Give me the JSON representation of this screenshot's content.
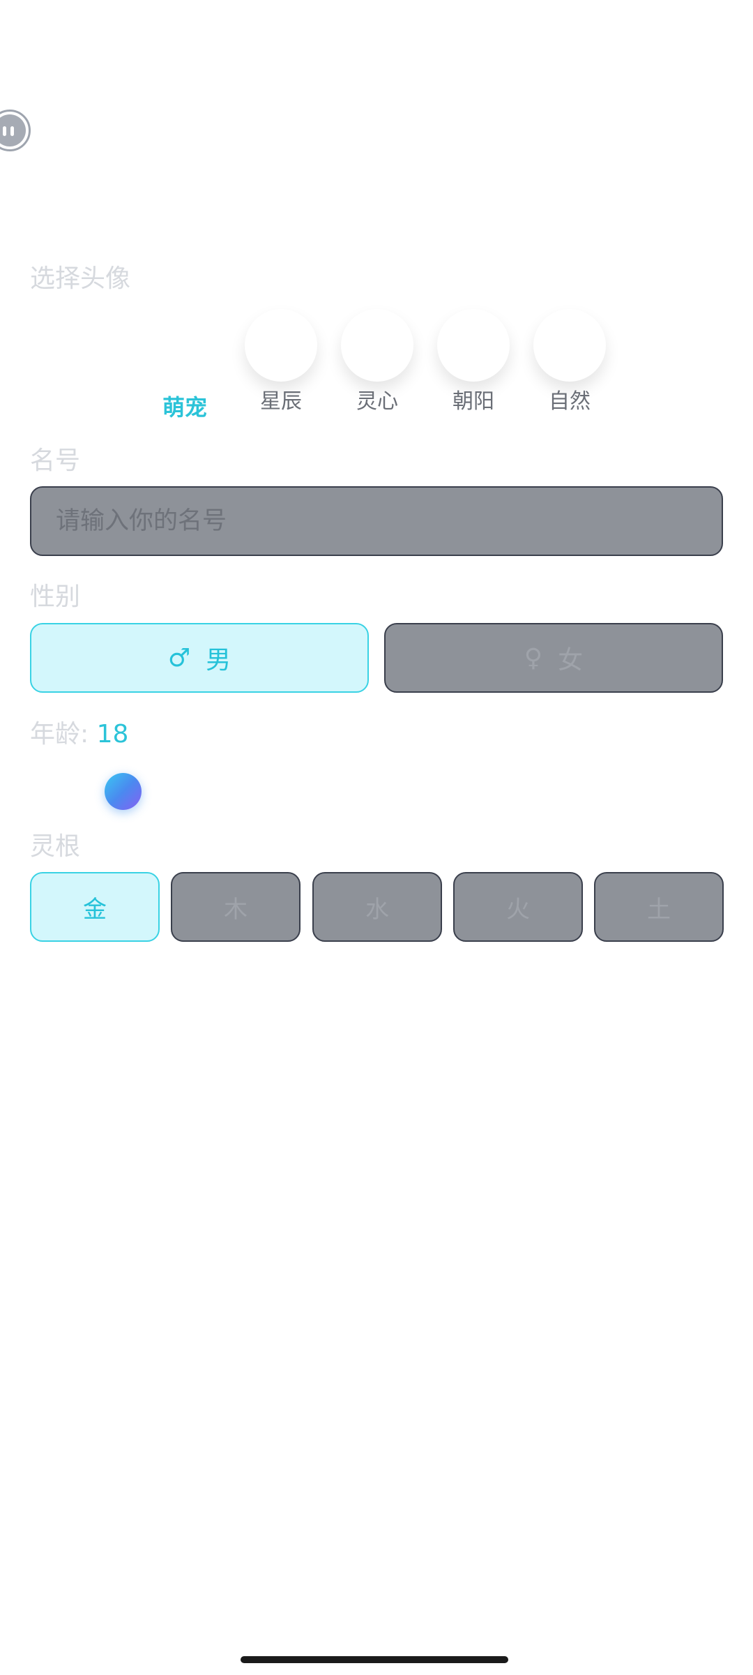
{
  "avatar_section": {
    "label": "选择头像",
    "options": [
      {
        "label": "萌宠",
        "selected": true
      },
      {
        "label": "星辰",
        "selected": false
      },
      {
        "label": "灵心",
        "selected": false
      },
      {
        "label": "朝阳",
        "selected": false
      },
      {
        "label": "自然",
        "selected": false
      }
    ]
  },
  "name_section": {
    "label": "名号",
    "placeholder": "请输入你的名号",
    "value": ""
  },
  "gender_section": {
    "label": "性别",
    "options": [
      {
        "symbol": "♂",
        "label": "男",
        "selected": true
      },
      {
        "symbol": "♀",
        "label": "女",
        "selected": false
      }
    ]
  },
  "age_section": {
    "label": "年龄: ",
    "value": "18"
  },
  "spirit_root_section": {
    "label": "灵根",
    "options": [
      {
        "label": "金",
        "selected": true
      },
      {
        "label": "木",
        "selected": false
      },
      {
        "label": "水",
        "selected": false
      },
      {
        "label": "火",
        "selected": false
      },
      {
        "label": "土",
        "selected": false
      }
    ]
  },
  "icons": {
    "mascot": "mascot-icon",
    "male": "male-symbol-icon",
    "female": "female-symbol-icon"
  },
  "colors": {
    "accent": "#2bc3d8",
    "active_bg": "#d3f7fc",
    "inactive_bg": "#8e9299",
    "inactive_border": "#3a3f4c"
  }
}
